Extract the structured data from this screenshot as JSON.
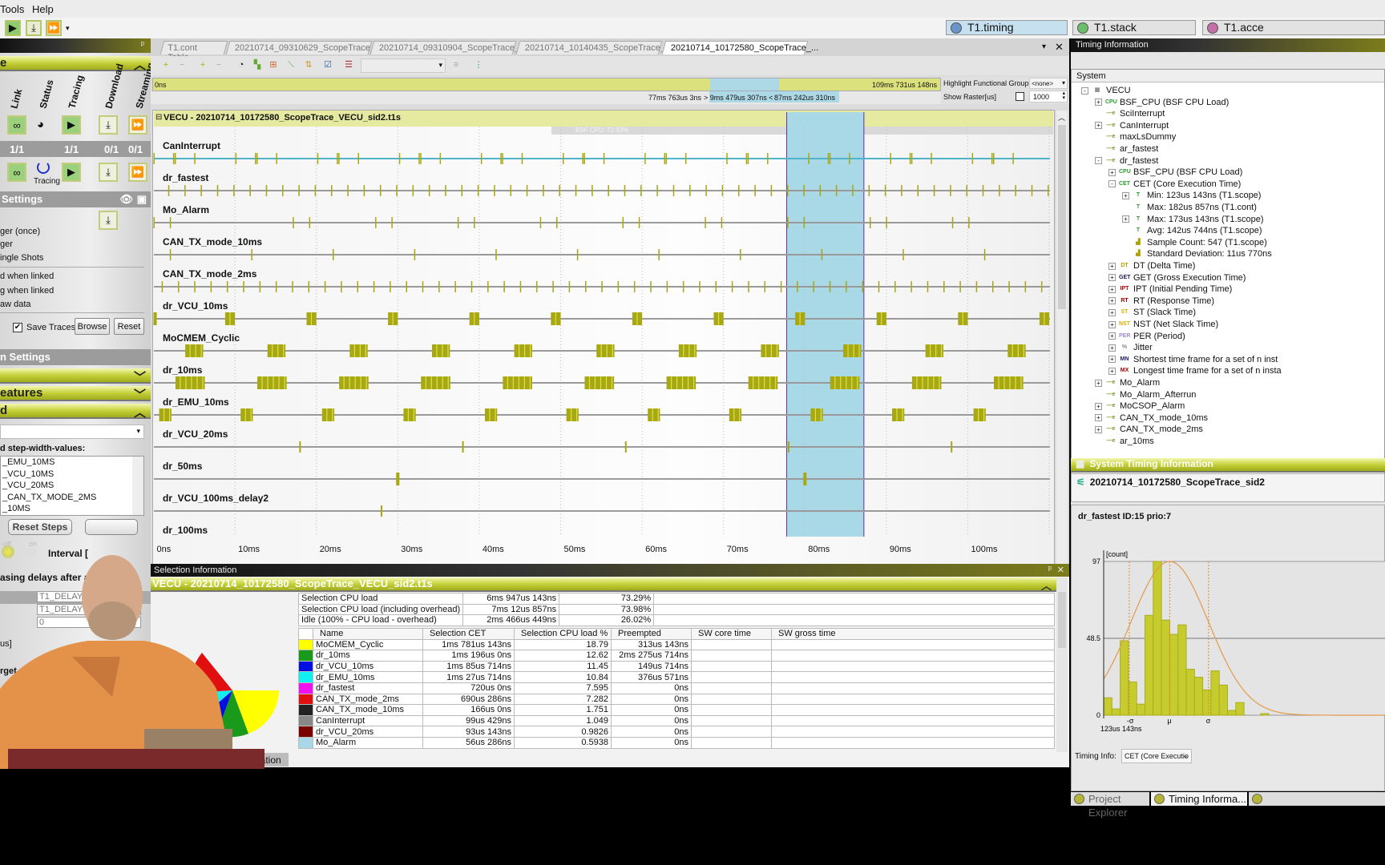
{
  "menu": {
    "items": [
      "Tools",
      "Help"
    ]
  },
  "top_tabs": [
    {
      "label": "T1.timing",
      "color": "#6b95c9"
    },
    {
      "label": "T1.stack",
      "color": "#6bbf6b"
    },
    {
      "label": "T1.acce",
      "color": "#c46fa8"
    }
  ],
  "left": {
    "panel_title": "e",
    "columns": [
      "Link",
      "Status",
      "Tracing",
      "Download",
      "Streaming"
    ],
    "counts": [
      "1/1",
      "1/1",
      "0/1",
      "0/1"
    ],
    "status_text": "Tracing",
    "settings_title": "Settings",
    "options": [
      "ger (once)",
      "ger",
      "ingle Shots"
    ],
    "linked_options": [
      "d when linked",
      "g when linked",
      "aw data"
    ],
    "save_traces": "Save Traces",
    "browse": "Browse",
    "reset": "Reset",
    "section2_title": "n Settings",
    "features_title": "eatures",
    "section3_title": "d",
    "step_label": "d step-width-values:",
    "step_list": [
      "_EMU_10MS",
      "_VCU_10MS",
      "_VCU_20MS",
      "_CAN_TX_MODE_2MS",
      "_10MS"
    ],
    "reset_steps": "Reset Steps",
    "toggle_off": "off",
    "toggle_on": "on",
    "interval_label": "Interval [",
    "delays_label": "asing delays after a s",
    "delay_table": [
      "T1_DELAY_E",
      "T1_DELAY",
      "0"
    ],
    "us_label": "us]",
    "target_label": "rget"
  },
  "doc_tabs": [
    "T1.cont Table",
    "20210714_09310629_ScopeTrace_...",
    "20210714_09310904_ScopeTrace_...",
    "20210714_10140435_ScopeTrace_...",
    "20210714_10172580_ScopeTrace_..."
  ],
  "overview": {
    "start": "0ns",
    "end": "109ms 731us 148ns",
    "sel_start": "77ms 763us 3ns",
    "sel_width": "> 9ms 479us 307ns <",
    "sel_end": "87ms 242us 310ns",
    "highlight_label": "Highlight Functional Group",
    "highlight_value": "<none>",
    "raster_label": "Show Raster[us]",
    "raster_value": "1000"
  },
  "trace": {
    "title": "VECU - 20210714_10172580_ScopeTrace_VECU_sid2.t1s",
    "cpu_band": "BSF CPU: 72.93%",
    "range_ms": [
      0,
      110
    ],
    "selection_ms": [
      77.76,
      87.24
    ],
    "axis_labels": [
      "0ns",
      "10ms",
      "20ms",
      "30ms",
      "40ms",
      "50ms",
      "60ms",
      "70ms",
      "80ms",
      "90ms",
      "100ms"
    ],
    "colors": {
      "event": "#a7a812",
      "line": "#9a9a9a",
      "selection": "#a9d9e6",
      "can_line": "#4fb3c9"
    },
    "tasks": [
      {
        "name": "CanInterrupt",
        "events": [
          [
            0,
            0.05
          ],
          [
            2.4,
            0.05
          ],
          [
            2.6,
            0.05
          ],
          [
            5.0,
            0.05
          ]
        ],
        "period": 10.05,
        "repeat": 11
      },
      {
        "name": "dr_fastest",
        "events": [
          [
            1.8,
            0.15
          ]
        ],
        "period": 2.0,
        "repeat": 55
      },
      {
        "name": "Mo_Alarm",
        "events": [
          [
            17.1,
            0.1
          ],
          [
            19.1,
            0.1
          ]
        ],
        "period": 10.12,
        "repeat": 9,
        "extra": [
          [
            0,
            0.1
          ],
          [
            2.0,
            0.1
          ]
        ]
      },
      {
        "name": "CAN_TX_mode_10ms",
        "events": [
          [
            2.0,
            0.15
          ]
        ],
        "period": 10.0,
        "repeat": 11
      },
      {
        "name": "CAN_TX_mode_2ms",
        "events": [
          [
            1.0,
            0.12
          ]
        ],
        "period": 2.0,
        "repeat": 55
      },
      {
        "name": "dr_VCU_10ms",
        "events": [
          [
            8.8,
            1.2
          ]
        ],
        "period": 10.0,
        "repeat": 11,
        "extra": [
          [
            0,
            0.4
          ]
        ]
      },
      {
        "name": "MoCMEM_Cyclic",
        "events": [
          [
            3.9,
            2.2
          ]
        ],
        "period": 10.1,
        "repeat": 11
      },
      {
        "name": "dr_10ms",
        "events": [
          [
            2.7,
            3.6
          ]
        ],
        "period": 10.05,
        "repeat": 11
      },
      {
        "name": "dr_EMU_10ms",
        "events": [
          [
            0.7,
            1.5
          ]
        ],
        "period": 10.0,
        "repeat": 11
      },
      {
        "name": "dr_VCU_20ms",
        "events": [
          [
            17.9,
            0.2
          ]
        ],
        "period": 20.0,
        "repeat": 5
      },
      {
        "name": "dr_50ms",
        "events": [
          [
            29.8,
            0.4
          ]
        ],
        "period": 50.0,
        "repeat": 2
      },
      {
        "name": "dr_VCU_100ms_delay2",
        "events": [
          [
            27.9,
            0.2
          ]
        ],
        "period": 100,
        "repeat": 1
      },
      {
        "name": "dr_100ms",
        "events": [],
        "period": 100,
        "repeat": 0
      }
    ]
  },
  "selection": {
    "header": "Selection Information",
    "title": "VECU - 20210714_10172580_ScopeTrace_VECU_sid2.t1s",
    "summary": [
      [
        "Selection CPU load",
        "6ms 947us 143ns",
        "73.29%"
      ],
      [
        "Selection CPU load (including overhead)",
        "7ms 12us 857ns",
        "73.98%"
      ],
      [
        "Idle (100% - CPU load - overhead)",
        "2ms 466us 449ns",
        "26.02%"
      ]
    ],
    "columns": [
      "Name",
      "Selection CET",
      "Selection CPU load %",
      "Preempted",
      "SW core time",
      "SW gross time"
    ],
    "rows": [
      {
        "color": "#ffff00",
        "name": "MoCMEM_Cyclic",
        "cet": "1ms 781us 143ns",
        "load": "18.79",
        "pre": "313us 143ns"
      },
      {
        "color": "#1a9a1a",
        "name": "dr_10ms",
        "cet": "1ms 196us 0ns",
        "load": "12.62",
        "pre": "2ms 275us 714ns"
      },
      {
        "color": "#0010e0",
        "name": "dr_VCU_10ms",
        "cet": "1ms 85us 714ns",
        "load": "11.45",
        "pre": "149us 714ns"
      },
      {
        "color": "#10f0f0",
        "name": "dr_EMU_10ms",
        "cet": "1ms 27us 714ns",
        "load": "10.84",
        "pre": "376us 571ns"
      },
      {
        "color": "#f010f0",
        "name": "dr_fastest",
        "cet": "720us 0ns",
        "load": "7.595",
        "pre": "0ns"
      },
      {
        "color": "#e01010",
        "name": "CAN_TX_mode_2ms",
        "cet": "690us 286ns",
        "load": "7.282",
        "pre": "0ns"
      },
      {
        "color": "#222222",
        "name": "CAN_TX_mode_10ms",
        "cet": "166us 0ns",
        "load": "1.751",
        "pre": "0ns"
      },
      {
        "color": "#888888",
        "name": "CanInterrupt",
        "cet": "99us 429ns",
        "load": "1.049",
        "pre": "0ns"
      },
      {
        "color": "#7a0000",
        "name": "dr_VCU_20ms",
        "cet": "93us 143ns",
        "load": "0.9826",
        "pre": "0ns"
      },
      {
        "color": "#a8d8e8",
        "name": "Mo_Alarm",
        "cet": "56us 286ns",
        "load": "0.5938",
        "pre": "0ns"
      }
    ]
  },
  "bottom_left_tab": "ormation",
  "right": {
    "header": "Timing Information",
    "system_label": "System",
    "tree": [
      {
        "lvl": 0,
        "exp": "-",
        "icon": "vecu",
        "label": "VECU"
      },
      {
        "lvl": 1,
        "exp": "+",
        "icon": "cpu",
        "label": "BSF_CPU (BSF CPU Load)"
      },
      {
        "lvl": 1,
        "exp": "",
        "icon": "task",
        "label": "SciInterrupt"
      },
      {
        "lvl": 1,
        "exp": "+",
        "icon": "task",
        "label": "CanInterrupt"
      },
      {
        "lvl": 1,
        "exp": "",
        "icon": "task",
        "label": "maxLsDummy"
      },
      {
        "lvl": 1,
        "exp": "",
        "icon": "task",
        "label": "ar_fastest"
      },
      {
        "lvl": 1,
        "exp": "-",
        "icon": "task",
        "label": "dr_fastest"
      },
      {
        "lvl": 2,
        "exp": "+",
        "icon": "cpu",
        "label": "BSF_CPU (BSF CPU Load)"
      },
      {
        "lvl": 2,
        "exp": "-",
        "icon": "CET",
        "label": "CET (Core Execution Time)"
      },
      {
        "lvl": 3,
        "exp": "+",
        "icon": "T",
        "label": "Min: 123us 143ns (T1.scope)"
      },
      {
        "lvl": 3,
        "exp": "",
        "icon": "T",
        "label": "Max: 182us 857ns (T1.cont)"
      },
      {
        "lvl": 3,
        "exp": "+",
        "icon": "T",
        "label": "Max: 173us 143ns (T1.scope)"
      },
      {
        "lvl": 3,
        "exp": "",
        "icon": "T",
        "label": "Avg: 142us 744ns (T1.scope)"
      },
      {
        "lvl": 3,
        "exp": "",
        "icon": "hist",
        "label": "Sample Count: 547 (T1.scope)"
      },
      {
        "lvl": 3,
        "exp": "",
        "icon": "hist",
        "label": "Standard Deviation: 11us 770ns"
      },
      {
        "lvl": 2,
        "exp": "+",
        "icon": "DT",
        "label": "DT (Delta Time)"
      },
      {
        "lvl": 2,
        "exp": "+",
        "icon": "GET",
        "label": "GET (Gross Execution Time)"
      },
      {
        "lvl": 2,
        "exp": "+",
        "icon": "IPT",
        "label": "IPT (Initial Pending Time)"
      },
      {
        "lvl": 2,
        "exp": "+",
        "icon": "RT",
        "label": "RT (Response Time)"
      },
      {
        "lvl": 2,
        "exp": "+",
        "icon": "ST",
        "label": "ST (Slack Time)"
      },
      {
        "lvl": 2,
        "exp": "+",
        "icon": "NST",
        "label": "NST (Net Slack Time)"
      },
      {
        "lvl": 2,
        "exp": "+",
        "icon": "PER",
        "label": "PER (Period)"
      },
      {
        "lvl": 2,
        "exp": "+",
        "icon": "%",
        "label": "Jitter"
      },
      {
        "lvl": 2,
        "exp": "+",
        "icon": "MN",
        "label": "Shortest time frame for a set of n inst"
      },
      {
        "lvl": 2,
        "exp": "+",
        "icon": "MX",
        "label": "Longest time frame for a set of n insta"
      },
      {
        "lvl": 1,
        "exp": "+",
        "icon": "task",
        "label": "Mo_Alarm"
      },
      {
        "lvl": 1,
        "exp": "",
        "icon": "task",
        "label": "Mo_Alarm_Afterrun"
      },
      {
        "lvl": 1,
        "exp": "+",
        "icon": "task",
        "label": "MoCSOP_Alarm"
      },
      {
        "lvl": 1,
        "exp": "+",
        "icon": "task",
        "label": "CAN_TX_mode_10ms"
      },
      {
        "lvl": 1,
        "exp": "+",
        "icon": "task",
        "label": "CAN_TX_mode_2ms"
      },
      {
        "lvl": 1,
        "exp": "",
        "icon": "task",
        "label": "ar_10ms"
      }
    ],
    "sys_timing_header": "System Timing Information",
    "sys_timing_item": "20210714_10172580_ScopeTrace_sid2",
    "hist_title": "dr_fastest ID:15 prio:7",
    "timing_info_label": "Timing Info:",
    "timing_info_value": "CET (Core Executio",
    "bottom_tabs": [
      "Project Explorer",
      "Timing Informa..."
    ]
  },
  "chart_data": {
    "type": "bar",
    "title": "dr_fastest ID:15 prio:7",
    "ylabel": "[count]",
    "ylim": [
      0,
      97
    ],
    "y_ticks": [
      "0",
      "48.5",
      "97"
    ],
    "x_start_label": "123us 143ns",
    "x_markers": [
      "-σ",
      "μ",
      "σ"
    ],
    "marker_bins": [
      3.1,
      8.0,
      12.7
    ],
    "values": [
      11,
      4,
      47,
      21,
      7,
      63,
      97,
      60,
      51,
      57,
      29,
      24,
      16,
      28,
      19,
      3,
      8,
      0,
      0,
      1
    ],
    "fit": "normal",
    "colors": {
      "bar": "#c7cc2e",
      "curve": "#e39a4a",
      "marker": "#e08a20"
    }
  }
}
